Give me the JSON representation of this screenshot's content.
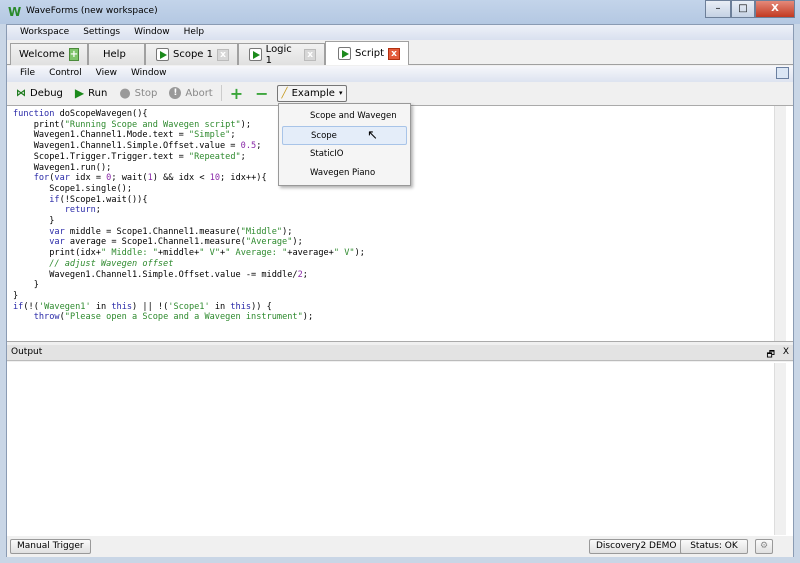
{
  "window": {
    "title": "WaveForms  (new workspace)",
    "logo": "W",
    "minimize": "–",
    "maximize": "□",
    "close": "X"
  },
  "main_menu": [
    "Workspace",
    "Settings",
    "Window",
    "Help"
  ],
  "tabs": [
    {
      "label": "Welcome",
      "icon": "plus-icon"
    },
    {
      "label": "Help"
    },
    {
      "label": "Scope 1",
      "icon": "play-icon",
      "close": "x"
    },
    {
      "label": "Logic 1",
      "icon": "play-icon",
      "close": "x"
    },
    {
      "label": "Script",
      "icon": "play-icon",
      "close": "x",
      "active": true
    }
  ],
  "script_menu": [
    "File",
    "Control",
    "View",
    "Window"
  ],
  "toolbar": {
    "debug": "Debug",
    "run": "Run",
    "stop": "Stop",
    "abort": "Abort",
    "add": "+",
    "remove": "−",
    "example": "Example"
  },
  "example_menu": {
    "items": [
      "Scope and Wavegen",
      "Scope",
      "StaticIO",
      "Wavegen Piano"
    ],
    "highlighted": "Scope"
  },
  "code": [
    [
      [
        "function",
        "kw"
      ],
      [
        " doScopeWavegen(){",
        ""
      ]
    ],
    [
      [
        "    print(",
        ""
      ],
      [
        "\"Running Scope and Wavegen script\"",
        "str"
      ],
      [
        ");",
        ""
      ]
    ],
    [
      [
        "    Wavegen1.Channel1.Mode.text = ",
        ""
      ],
      [
        "\"Simple\"",
        "str"
      ],
      [
        ";",
        ""
      ]
    ],
    [
      [
        "    Wavegen1.Channel1.Simple.Offset.value = ",
        ""
      ],
      [
        "0.5",
        "num"
      ],
      [
        ";",
        ""
      ]
    ],
    [
      [
        "    Scope1.Trigger.Trigger.text = ",
        ""
      ],
      [
        "\"Repeated\"",
        "str"
      ],
      [
        ";",
        ""
      ]
    ],
    [
      [
        "    Wavegen1.run();",
        ""
      ]
    ],
    [
      [
        "    ",
        ""
      ],
      [
        "for",
        "kw"
      ],
      [
        "(",
        ""
      ],
      [
        "var",
        "kw"
      ],
      [
        " idx = ",
        ""
      ],
      [
        "0",
        "num"
      ],
      [
        "; wait(",
        ""
      ],
      [
        "1",
        "num"
      ],
      [
        ") && idx < ",
        ""
      ],
      [
        "10",
        "num"
      ],
      [
        "; idx++){",
        ""
      ]
    ],
    [
      [
        "       Scope1.single();",
        ""
      ]
    ],
    [
      [
        "       ",
        ""
      ],
      [
        "if",
        "kw"
      ],
      [
        "(!Scope1.wait()){",
        ""
      ]
    ],
    [
      [
        "          ",
        ""
      ],
      [
        "return",
        "kw"
      ],
      [
        ";",
        ""
      ]
    ],
    [
      [
        "       }",
        ""
      ]
    ],
    [
      [
        "       ",
        ""
      ],
      [
        "var",
        "kw"
      ],
      [
        " middle = Scope1.Channel1.measure(",
        ""
      ],
      [
        "\"Middle\"",
        "str"
      ],
      [
        ");",
        ""
      ]
    ],
    [
      [
        "       ",
        ""
      ],
      [
        "var",
        "kw"
      ],
      [
        " average = Scope1.Channel1.measure(",
        ""
      ],
      [
        "\"Average\"",
        "str"
      ],
      [
        ");",
        ""
      ]
    ],
    [
      [
        "       print(idx+",
        ""
      ],
      [
        "\" Middle: \"",
        "str"
      ],
      [
        "+middle+",
        ""
      ],
      [
        "\" V\"",
        "str"
      ],
      [
        "+",
        ""
      ],
      [
        "\" Average: \"",
        "str"
      ],
      [
        "+average+",
        ""
      ],
      [
        "\" V\"",
        "str"
      ],
      [
        ");",
        ""
      ]
    ],
    [
      [
        "       ",
        ""
      ],
      [
        "// adjust Wavegen offset",
        "cm"
      ]
    ],
    [
      [
        "       Wavegen1.Channel1.Simple.Offset.value -= middle/",
        ""
      ],
      [
        "2",
        "num"
      ],
      [
        ";",
        ""
      ]
    ],
    [
      [
        "    }",
        ""
      ]
    ],
    [
      [
        "}",
        ""
      ]
    ],
    [
      [
        "if",
        "kw"
      ],
      [
        "(!(",
        ""
      ],
      [
        "'Wavegen1'",
        "str"
      ],
      [
        " in ",
        ""
      ],
      [
        "this",
        "kw"
      ],
      [
        ") || !(",
        ""
      ],
      [
        "'Scope1'",
        "str"
      ],
      [
        " in ",
        ""
      ],
      [
        "this",
        "kw"
      ],
      [
        ")) {",
        ""
      ]
    ],
    [
      [
        "    ",
        ""
      ],
      [
        "throw",
        "kw"
      ],
      [
        "(",
        ""
      ],
      [
        "\"Please open a Scope and a Wavegen instrument\"",
        "str"
      ],
      [
        ");",
        ""
      ]
    ]
  ],
  "output": {
    "title": "Output",
    "float": "🗗",
    "close": "X"
  },
  "statusbar": {
    "manual_trigger": "Manual Trigger",
    "device": "Discovery2 DEMO",
    "status": "Status: OK"
  }
}
